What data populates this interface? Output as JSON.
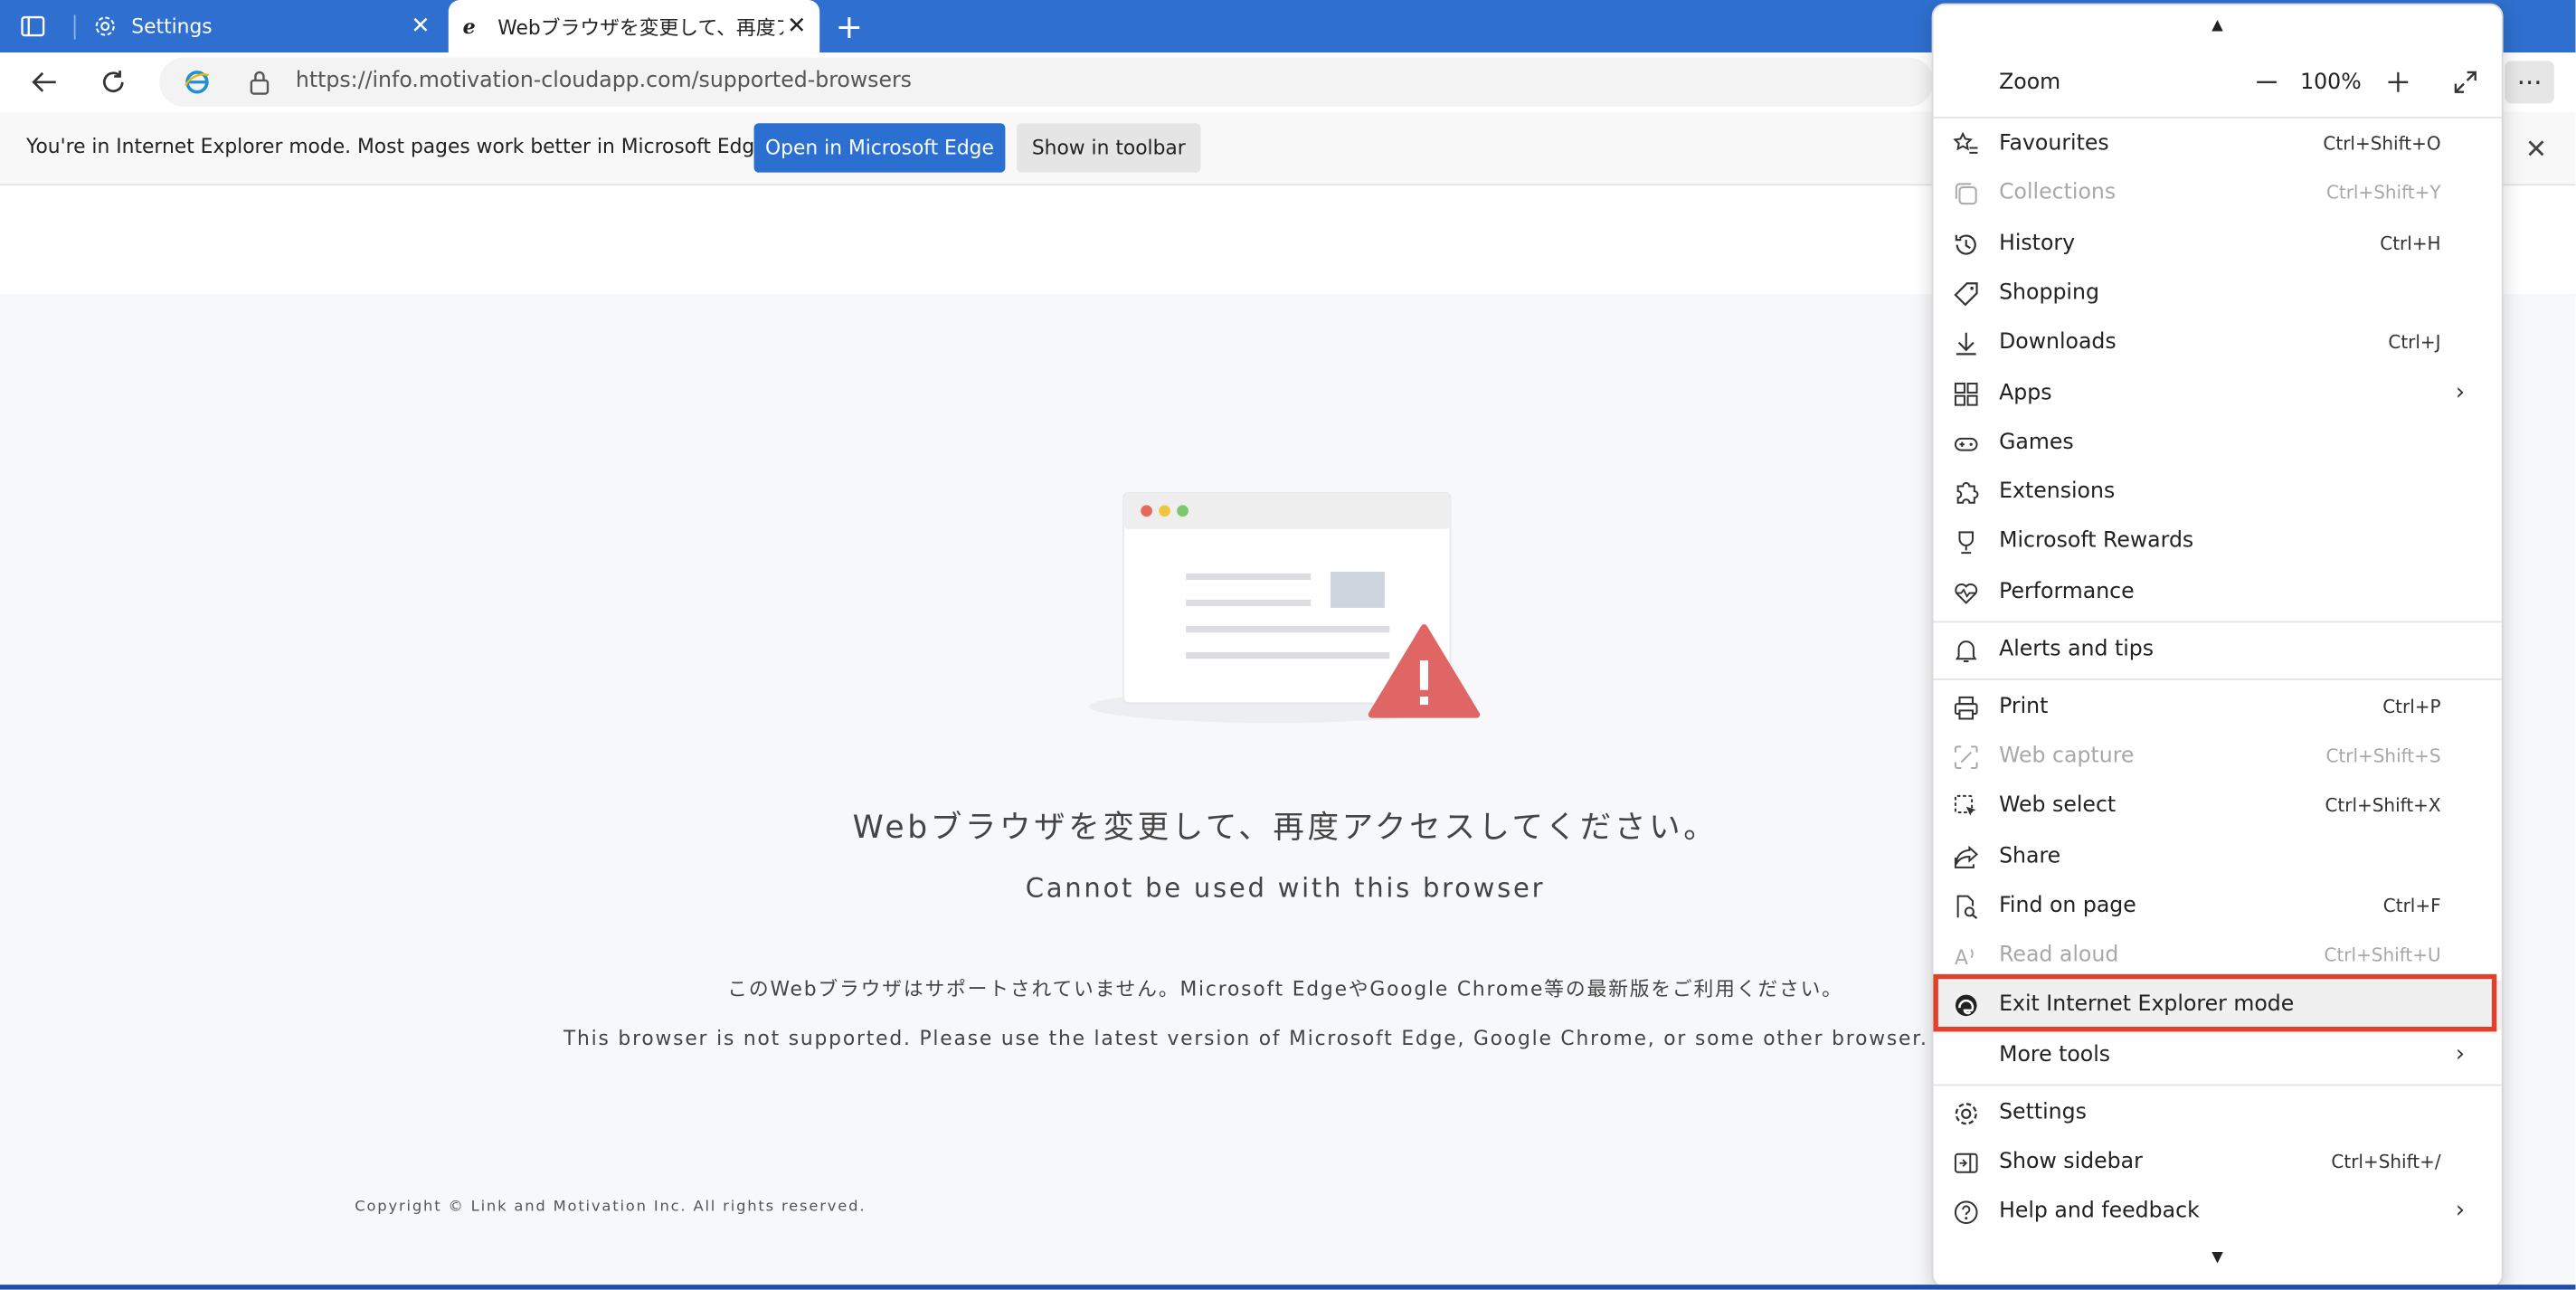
{
  "tabs": [
    {
      "label": "Settings",
      "icon": "gear-icon"
    },
    {
      "label": "Webブラウザを変更して、再度アクセ",
      "icon": "ie-icon"
    }
  ],
  "address": {
    "url": "https://info.motivation-cloudapp.com/supported-browsers"
  },
  "iebar": {
    "message": "You're in Internet Explorer mode. Most pages work better in Microsoft Edge.",
    "open_label": "Open in Microsoft Edge",
    "show_label": "Show in toolbar"
  },
  "page": {
    "jp_heading": "Webブラウザを変更して、再度アクセスしてください。",
    "en_heading": "Cannot be used with this browser",
    "jp_body": "このWebブラウザはサポートされていません。Microsoft EdgeやGoogle Chrome等の最新版をご利用ください。",
    "en_body": "This browser is not supported. Please use the latest version of Microsoft Edge, Google Chrome, or some other browser.",
    "copyright": "Copyright © Link and Motivation Inc. All rights reserved."
  },
  "menu": {
    "zoom_label": "Zoom",
    "zoom_value": "100%",
    "items": [
      {
        "label": "Favourites",
        "shortcut": "Ctrl+Shift+O",
        "icon": "star-list-icon"
      },
      {
        "label": "Collections",
        "shortcut": "Ctrl+Shift+Y",
        "icon": "collections-icon"
      },
      {
        "label": "History",
        "shortcut": "Ctrl+H",
        "icon": "history-icon"
      },
      {
        "label": "Shopping",
        "shortcut": "",
        "icon": "tag-icon"
      },
      {
        "label": "Downloads",
        "shortcut": "Ctrl+J",
        "icon": "download-icon"
      },
      {
        "label": "Apps",
        "shortcut": "",
        "icon": "apps-icon"
      },
      {
        "label": "Games",
        "shortcut": "",
        "icon": "games-icon"
      },
      {
        "label": "Extensions",
        "shortcut": "",
        "icon": "puzzle-icon"
      },
      {
        "label": "Microsoft Rewards",
        "shortcut": "",
        "icon": "trophy-icon"
      },
      {
        "label": "Performance",
        "shortcut": "",
        "icon": "heart-pulse-icon"
      },
      {
        "label": "Alerts and tips",
        "shortcut": "",
        "icon": "bell-icon"
      },
      {
        "label": "Print",
        "shortcut": "Ctrl+P",
        "icon": "printer-icon"
      },
      {
        "label": "Web capture",
        "shortcut": "Ctrl+Shift+S",
        "icon": "capture-icon"
      },
      {
        "label": "Web select",
        "shortcut": "Ctrl+Shift+X",
        "icon": "select-icon"
      },
      {
        "label": "Share",
        "shortcut": "",
        "icon": "share-icon"
      },
      {
        "label": "Find on page",
        "shortcut": "Ctrl+F",
        "icon": "find-icon"
      },
      {
        "label": "Read aloud",
        "shortcut": "Ctrl+Shift+U",
        "icon": "read-aloud-icon"
      },
      {
        "label": "Exit Internet Explorer mode",
        "shortcut": "",
        "icon": "edge-icon"
      },
      {
        "label": "More tools",
        "shortcut": "",
        "icon": ""
      },
      {
        "label": "Settings",
        "shortcut": "",
        "icon": "gear-icon"
      },
      {
        "label": "Show sidebar",
        "shortcut": "Ctrl+Shift+/",
        "icon": "sidebar-icon"
      },
      {
        "label": "Help and feedback",
        "shortcut": "",
        "icon": "help-icon"
      }
    ]
  },
  "colors": {
    "tabstrip": "#2f6fcf",
    "primary_button": "#2b6fd0",
    "highlight_box": "#e2402a",
    "warning": "#e06666"
  }
}
